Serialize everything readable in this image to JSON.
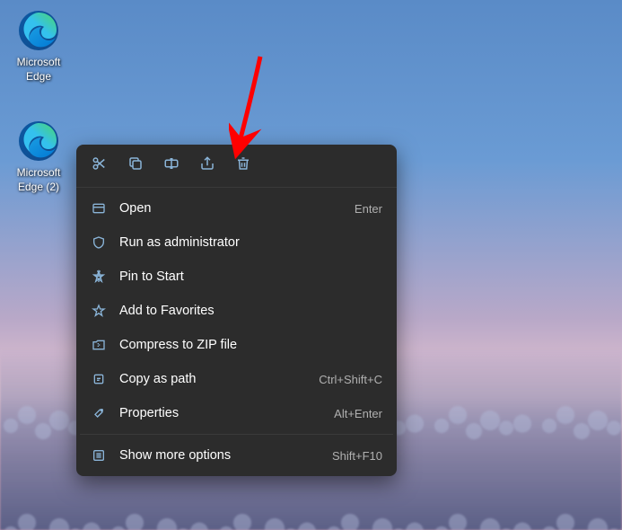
{
  "desktop_icons": [
    {
      "label": "Microsoft Edge"
    },
    {
      "label": "Microsoft Edge (2)"
    }
  ],
  "context_menu": {
    "toolbar": [
      {
        "name": "cut"
      },
      {
        "name": "copy"
      },
      {
        "name": "rename"
      },
      {
        "name": "share"
      },
      {
        "name": "delete"
      }
    ],
    "items": [
      {
        "label": "Open",
        "shortcut": "Enter"
      },
      {
        "label": "Run as administrator",
        "shortcut": ""
      },
      {
        "label": "Pin to Start",
        "shortcut": ""
      },
      {
        "label": "Add to Favorites",
        "shortcut": ""
      },
      {
        "label": "Compress to ZIP file",
        "shortcut": ""
      },
      {
        "label": "Copy as path",
        "shortcut": "Ctrl+Shift+C"
      },
      {
        "label": "Properties",
        "shortcut": "Alt+Enter"
      }
    ],
    "more_options": {
      "label": "Show more options",
      "shortcut": "Shift+F10"
    }
  }
}
